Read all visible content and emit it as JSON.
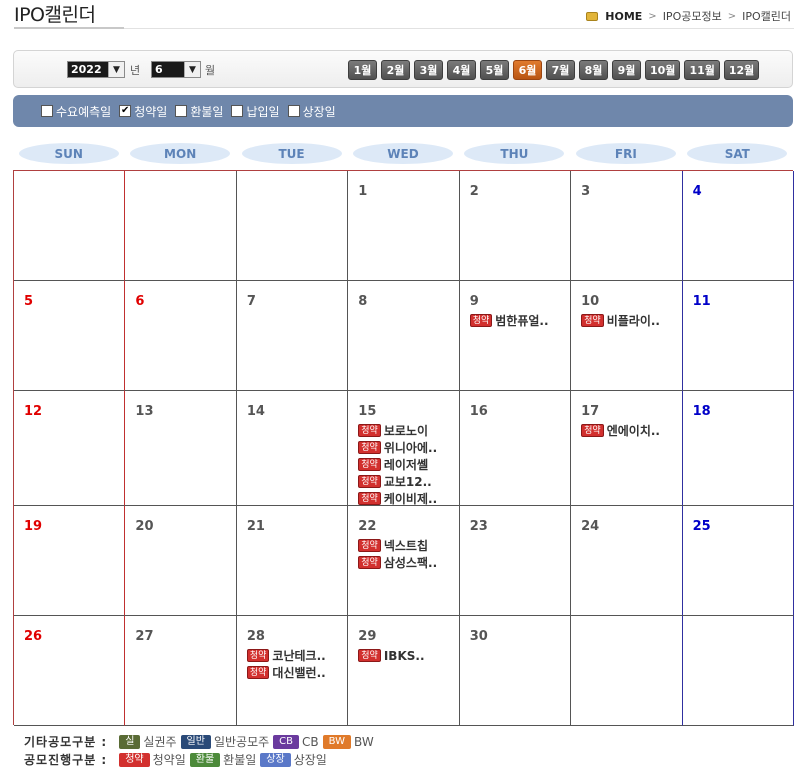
{
  "header": {
    "title": "IPO캘린더",
    "breadcrumb": [
      "HOME",
      "IPO공모정보",
      "IPO캘린더"
    ]
  },
  "toolbar": {
    "year": "2022",
    "year_unit": "년",
    "month": "6",
    "month_unit": "월",
    "months": [
      "1월",
      "2월",
      "3월",
      "4월",
      "5월",
      "6월",
      "7월",
      "8월",
      "9월",
      "10월",
      "11월",
      "12월"
    ],
    "active_month_index": 5
  },
  "filters": [
    {
      "label": "수요예측일",
      "checked": false
    },
    {
      "label": "청약일",
      "checked": true
    },
    {
      "label": "환불일",
      "checked": false
    },
    {
      "label": "납입일",
      "checked": false
    },
    {
      "label": "상장일",
      "checked": false
    }
  ],
  "weekdays": [
    "SUN",
    "MON",
    "TUE",
    "WED",
    "THU",
    "FRI",
    "SAT"
  ],
  "tag_label": "청약",
  "calendar": [
    [
      {
        "day": ""
      },
      {
        "day": ""
      },
      {
        "day": ""
      },
      {
        "day": "1"
      },
      {
        "day": "2"
      },
      {
        "day": "3"
      },
      {
        "day": "4"
      }
    ],
    [
      {
        "day": "5"
      },
      {
        "day": "6"
      },
      {
        "day": "7"
      },
      {
        "day": "8"
      },
      {
        "day": "9",
        "events": [
          "범한퓨얼.."
        ]
      },
      {
        "day": "10",
        "events": [
          "비플라이.."
        ]
      },
      {
        "day": "11"
      }
    ],
    [
      {
        "day": "12"
      },
      {
        "day": "13"
      },
      {
        "day": "14"
      },
      {
        "day": "15",
        "events": [
          "보로노이",
          "위니아에..",
          "레이저쎌",
          "교보12..",
          "케이비제.."
        ]
      },
      {
        "day": "16"
      },
      {
        "day": "17",
        "events": [
          "엔에이치.."
        ]
      },
      {
        "day": "18"
      }
    ],
    [
      {
        "day": "19"
      },
      {
        "day": "20"
      },
      {
        "day": "21"
      },
      {
        "day": "22",
        "events": [
          "넥스트칩",
          "삼성스팩.."
        ]
      },
      {
        "day": "23"
      },
      {
        "day": "24"
      },
      {
        "day": "25"
      }
    ],
    [
      {
        "day": "26"
      },
      {
        "day": "27"
      },
      {
        "day": "28",
        "events": [
          "코난테크..",
          "대신밸런.."
        ]
      },
      {
        "day": "29",
        "events": [
          "IBKS.."
        ]
      },
      {
        "day": "30"
      },
      {
        "day": ""
      },
      {
        "day": ""
      }
    ]
  ],
  "holidays": [
    "6"
  ],
  "legend": {
    "other_label": "기타공모구분 :",
    "other": [
      {
        "tag": "실",
        "text": "실권주",
        "color": "#5a6b35"
      },
      {
        "tag": "일반",
        "text": "일반공모주",
        "color": "#2a4a78"
      },
      {
        "tag": "CB",
        "text": "CB",
        "color": "#6a3a9e"
      },
      {
        "tag": "BW",
        "text": "BW",
        "color": "#e07a2a"
      }
    ],
    "progress_label": "공모진행구분 :",
    "progress": [
      {
        "tag": "청약",
        "text": "청약일",
        "color": "#d2302e"
      },
      {
        "tag": "환불",
        "text": "환불일",
        "color": "#4c8a3a"
      },
      {
        "tag": "상장",
        "text": "상장일",
        "color": "#5a78c8"
      }
    ]
  }
}
